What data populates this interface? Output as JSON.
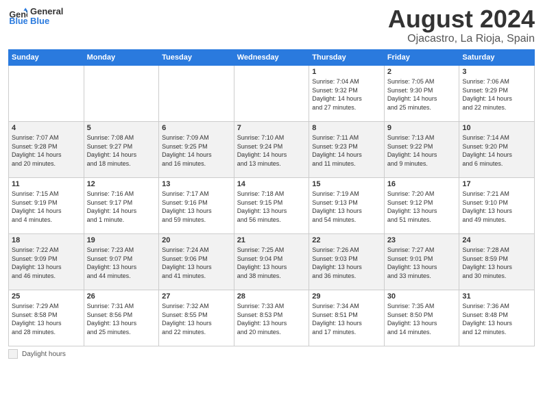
{
  "header": {
    "logo_general": "General",
    "logo_blue": "Blue",
    "month": "August 2024",
    "location": "Ojacastro, La Rioja, Spain"
  },
  "days_of_week": [
    "Sunday",
    "Monday",
    "Tuesday",
    "Wednesday",
    "Thursday",
    "Friday",
    "Saturday"
  ],
  "weeks": [
    [
      {
        "day": "",
        "info": ""
      },
      {
        "day": "",
        "info": ""
      },
      {
        "day": "",
        "info": ""
      },
      {
        "day": "",
        "info": ""
      },
      {
        "day": "1",
        "info": "Sunrise: 7:04 AM\nSunset: 9:32 PM\nDaylight: 14 hours\nand 27 minutes."
      },
      {
        "day": "2",
        "info": "Sunrise: 7:05 AM\nSunset: 9:30 PM\nDaylight: 14 hours\nand 25 minutes."
      },
      {
        "day": "3",
        "info": "Sunrise: 7:06 AM\nSunset: 9:29 PM\nDaylight: 14 hours\nand 22 minutes."
      }
    ],
    [
      {
        "day": "4",
        "info": "Sunrise: 7:07 AM\nSunset: 9:28 PM\nDaylight: 14 hours\nand 20 minutes."
      },
      {
        "day": "5",
        "info": "Sunrise: 7:08 AM\nSunset: 9:27 PM\nDaylight: 14 hours\nand 18 minutes."
      },
      {
        "day": "6",
        "info": "Sunrise: 7:09 AM\nSunset: 9:25 PM\nDaylight: 14 hours\nand 16 minutes."
      },
      {
        "day": "7",
        "info": "Sunrise: 7:10 AM\nSunset: 9:24 PM\nDaylight: 14 hours\nand 13 minutes."
      },
      {
        "day": "8",
        "info": "Sunrise: 7:11 AM\nSunset: 9:23 PM\nDaylight: 14 hours\nand 11 minutes."
      },
      {
        "day": "9",
        "info": "Sunrise: 7:13 AM\nSunset: 9:22 PM\nDaylight: 14 hours\nand 9 minutes."
      },
      {
        "day": "10",
        "info": "Sunrise: 7:14 AM\nSunset: 9:20 PM\nDaylight: 14 hours\nand 6 minutes."
      }
    ],
    [
      {
        "day": "11",
        "info": "Sunrise: 7:15 AM\nSunset: 9:19 PM\nDaylight: 14 hours\nand 4 minutes."
      },
      {
        "day": "12",
        "info": "Sunrise: 7:16 AM\nSunset: 9:17 PM\nDaylight: 14 hours\nand 1 minute."
      },
      {
        "day": "13",
        "info": "Sunrise: 7:17 AM\nSunset: 9:16 PM\nDaylight: 13 hours\nand 59 minutes."
      },
      {
        "day": "14",
        "info": "Sunrise: 7:18 AM\nSunset: 9:15 PM\nDaylight: 13 hours\nand 56 minutes."
      },
      {
        "day": "15",
        "info": "Sunrise: 7:19 AM\nSunset: 9:13 PM\nDaylight: 13 hours\nand 54 minutes."
      },
      {
        "day": "16",
        "info": "Sunrise: 7:20 AM\nSunset: 9:12 PM\nDaylight: 13 hours\nand 51 minutes."
      },
      {
        "day": "17",
        "info": "Sunrise: 7:21 AM\nSunset: 9:10 PM\nDaylight: 13 hours\nand 49 minutes."
      }
    ],
    [
      {
        "day": "18",
        "info": "Sunrise: 7:22 AM\nSunset: 9:09 PM\nDaylight: 13 hours\nand 46 minutes."
      },
      {
        "day": "19",
        "info": "Sunrise: 7:23 AM\nSunset: 9:07 PM\nDaylight: 13 hours\nand 44 minutes."
      },
      {
        "day": "20",
        "info": "Sunrise: 7:24 AM\nSunset: 9:06 PM\nDaylight: 13 hours\nand 41 minutes."
      },
      {
        "day": "21",
        "info": "Sunrise: 7:25 AM\nSunset: 9:04 PM\nDaylight: 13 hours\nand 38 minutes."
      },
      {
        "day": "22",
        "info": "Sunrise: 7:26 AM\nSunset: 9:03 PM\nDaylight: 13 hours\nand 36 minutes."
      },
      {
        "day": "23",
        "info": "Sunrise: 7:27 AM\nSunset: 9:01 PM\nDaylight: 13 hours\nand 33 minutes."
      },
      {
        "day": "24",
        "info": "Sunrise: 7:28 AM\nSunset: 8:59 PM\nDaylight: 13 hours\nand 30 minutes."
      }
    ],
    [
      {
        "day": "25",
        "info": "Sunrise: 7:29 AM\nSunset: 8:58 PM\nDaylight: 13 hours\nand 28 minutes."
      },
      {
        "day": "26",
        "info": "Sunrise: 7:31 AM\nSunset: 8:56 PM\nDaylight: 13 hours\nand 25 minutes."
      },
      {
        "day": "27",
        "info": "Sunrise: 7:32 AM\nSunset: 8:55 PM\nDaylight: 13 hours\nand 22 minutes."
      },
      {
        "day": "28",
        "info": "Sunrise: 7:33 AM\nSunset: 8:53 PM\nDaylight: 13 hours\nand 20 minutes."
      },
      {
        "day": "29",
        "info": "Sunrise: 7:34 AM\nSunset: 8:51 PM\nDaylight: 13 hours\nand 17 minutes."
      },
      {
        "day": "30",
        "info": "Sunrise: 7:35 AM\nSunset: 8:50 PM\nDaylight: 13 hours\nand 14 minutes."
      },
      {
        "day": "31",
        "info": "Sunrise: 7:36 AM\nSunset: 8:48 PM\nDaylight: 13 hours\nand 12 minutes."
      }
    ]
  ],
  "footer": {
    "daylight_label": "Daylight hours"
  }
}
